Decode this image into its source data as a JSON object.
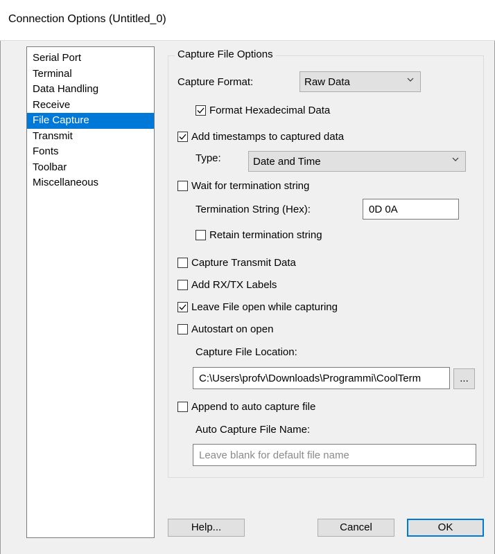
{
  "window": {
    "title": "Connection Options (Untitled_0)"
  },
  "nav": {
    "items": [
      {
        "label": "Serial Port",
        "selected": false
      },
      {
        "label": "Terminal",
        "selected": false
      },
      {
        "label": "Data Handling",
        "selected": false
      },
      {
        "label": "Receive",
        "selected": false
      },
      {
        "label": "File Capture",
        "selected": true
      },
      {
        "label": "Transmit",
        "selected": false
      },
      {
        "label": "Fonts",
        "selected": false
      },
      {
        "label": "Toolbar",
        "selected": false
      },
      {
        "label": "Miscellaneous",
        "selected": false
      }
    ]
  },
  "capture": {
    "group_title": "Capture File Options",
    "format_label": "Capture Format:",
    "format_value": "Raw Data",
    "hex_label": "Format Hexadecimal Data",
    "hex_checked": true,
    "timestamps_label": "Add timestamps to captured data",
    "timestamps_checked": true,
    "type_label": "Type:",
    "type_value": "Date and Time",
    "wait_label": "Wait for termination string",
    "wait_checked": false,
    "term_label": "Termination String (Hex):",
    "term_value": "0D 0A",
    "retain_label": "Retain termination string",
    "retain_checked": false,
    "transmit_label": "Capture Transmit Data",
    "transmit_checked": false,
    "rxtx_label": "Add RX/TX Labels",
    "rxtx_checked": false,
    "leave_open_label": "Leave File open while capturing",
    "leave_open_checked": true,
    "autostart_label": "Autostart on open",
    "autostart_checked": false,
    "location_label": "Capture File Location:",
    "location_value": "C:\\Users\\profv\\Downloads\\Programmi\\CoolTerm",
    "browse_label": "...",
    "append_label": "Append to auto capture file",
    "append_checked": false,
    "auto_name_label": "Auto Capture File Name:",
    "auto_name_placeholder": "Leave blank for default file name",
    "auto_name_value": ""
  },
  "buttons": {
    "help": "Help...",
    "cancel": "Cancel",
    "ok": "OK"
  },
  "colors": {
    "selection": "#0078d7",
    "dialog_bg": "#f0f0f0"
  }
}
